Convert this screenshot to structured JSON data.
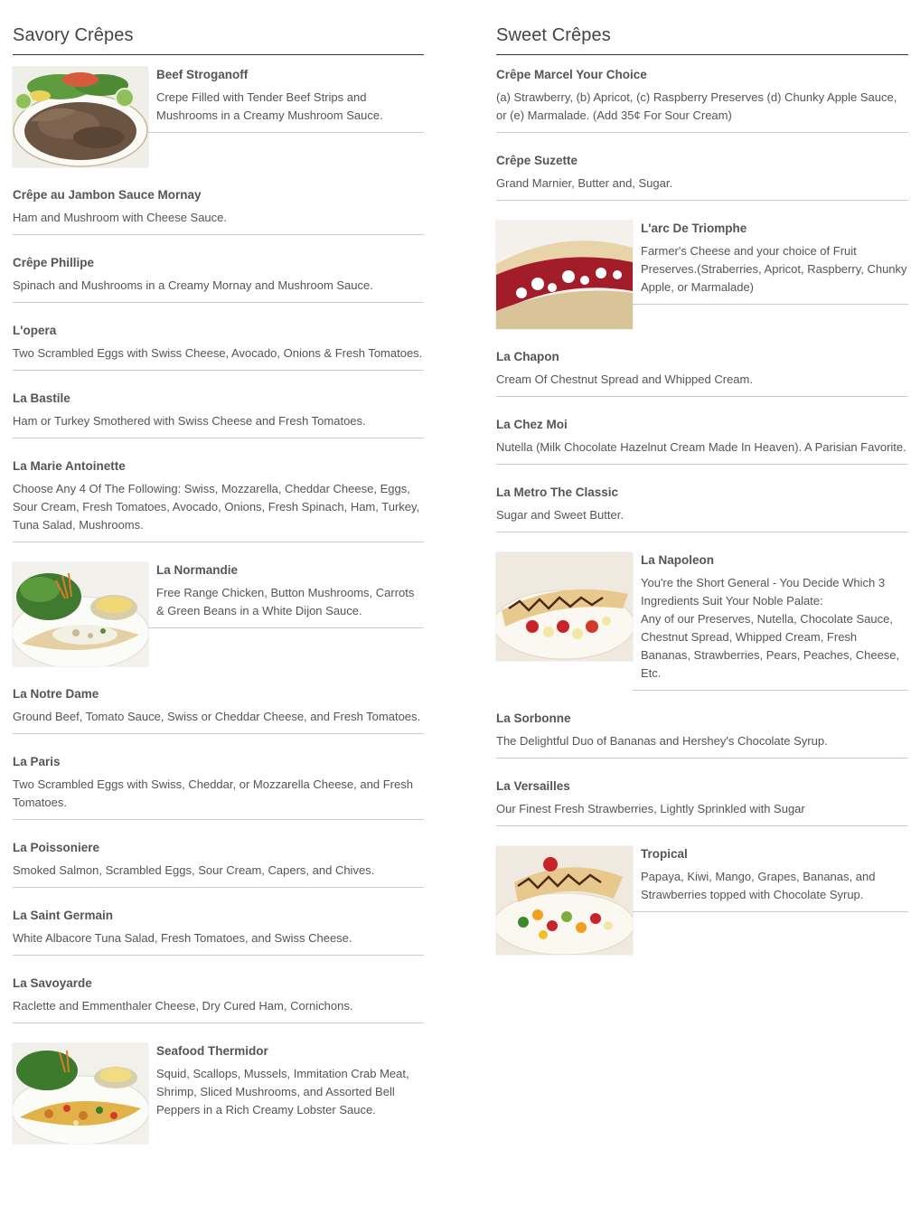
{
  "savory": {
    "title": "Savory Crêpes",
    "items": [
      {
        "name": "Beef Stroganoff",
        "desc": "Crepe Filled with Tender Beef Strips and Mushrooms in a Creamy Mushroom Sauce."
      },
      {
        "name": "Crêpe au Jambon Sauce Mornay",
        "desc": "Ham and Mushroom with Cheese Sauce."
      },
      {
        "name": "Crêpe Phillipe",
        "desc": "Spinach and Mushrooms in a Creamy Mornay and Mushroom Sauce."
      },
      {
        "name": "L'opera",
        "desc": "Two Scrambled Eggs with Swiss Cheese, Avocado, Onions & Fresh Tomatoes."
      },
      {
        "name": "La Bastile",
        "desc": "Ham or Turkey Smothered with Swiss Cheese and Fresh Tomatoes."
      },
      {
        "name": "La Marie Antoinette",
        "desc": "Choose Any 4 Of The Following: Swiss, Mozzarella, Cheddar Cheese, Eggs, Sour Cream, Fresh Tomatoes, Avocado, Onions, Fresh Spinach, Ham, Turkey, Tuna Salad, Mushrooms."
      },
      {
        "name": "La Normandie",
        "desc": "Free Range Chicken, Button Mushrooms, Carrots & Green Beans in a White Dijon Sauce."
      },
      {
        "name": "La Notre Dame",
        "desc": "Ground Beef, Tomato Sauce, Swiss or Cheddar Cheese, and Fresh Tomatoes."
      },
      {
        "name": "La Paris",
        "desc": "Two Scrambled Eggs with Swiss, Cheddar, or Mozzarella Cheese, and Fresh Tomatoes."
      },
      {
        "name": "La Poissoniere",
        "desc": "Smoked Salmon, Scrambled Eggs, Sour Cream, Capers, and Chives."
      },
      {
        "name": "La Saint Germain",
        "desc": "White Albacore Tuna Salad, Fresh Tomatoes, and Swiss Cheese."
      },
      {
        "name": "La Savoyarde",
        "desc": "Raclette and Emmenthaler Cheese, Dry Cured Ham, Cornichons."
      },
      {
        "name": "Seafood Thermidor",
        "desc": "Squid, Scallops, Mussels, Immitation Crab Meat, Shrimp, Sliced Mushrooms, and Assorted Bell Peppers in a Rich Creamy Lobster Sauce."
      }
    ]
  },
  "sweet": {
    "title": "Sweet Crêpes",
    "items": [
      {
        "name": "Crêpe Marcel Your Choice",
        "desc": "(a) Strawberry, (b) Apricot, (c) Raspberry Preserves (d) Chunky Apple Sauce, or (e) Marmalade. (Add 35¢ For Sour Cream)"
      },
      {
        "name": "Crêpe Suzette",
        "desc": "Grand Marnier, Butter and, Sugar."
      },
      {
        "name": "L'arc De Triomphe",
        "desc": "Farmer's Cheese and your choice of Fruit Preserves.(Straberries, Apricot, Raspberry, Chunky Apple, or Marmalade)"
      },
      {
        "name": "La Chapon",
        "desc": "Cream Of Chestnut Spread and Whipped Cream."
      },
      {
        "name": "La Chez Moi",
        "desc": "Nutella (Milk Chocolate Hazelnut Cream Made In Heaven). A Parisian Favorite."
      },
      {
        "name": "La Metro The Classic",
        "desc": "Sugar and Sweet Butter."
      },
      {
        "name": "La Napoleon",
        "desc": "You're the Short General - You Decide Which 3 Ingredients Suit Your Noble Palate:",
        "desc2": "Any of our Preserves, Nutella, Chocolate Sauce, Chestnut Spread, Whipped Cream, Fresh Bananas, Strawberries, Pears, Peaches, Cheese, Etc."
      },
      {
        "name": "La Sorbonne",
        "desc": "The Delightful Duo of Bananas and Hershey's Chocolate Syrup."
      },
      {
        "name": "La Versailles",
        "desc": "Our Finest Fresh Strawberries, Lightly Sprinkled with Sugar"
      },
      {
        "name": "Tropical",
        "desc": "Papaya, Kiwi, Mango, Grapes, Bananas, and Strawberries topped with Chocolate Syrup."
      }
    ]
  },
  "colors": {
    "text": "#555555",
    "rule": "#cccccc",
    "title_rule": "#333333",
    "background": "#ffffff"
  }
}
